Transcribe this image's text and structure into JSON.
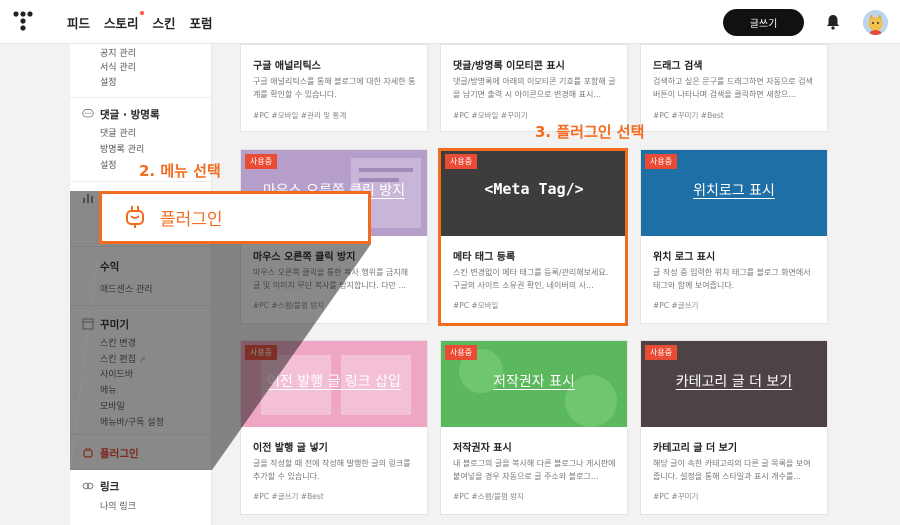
{
  "header": {
    "nav": [
      "피드",
      "스토리",
      "스킨",
      "포럼"
    ],
    "write_label": "글쓰기"
  },
  "sidebar": {
    "top_items": [
      "공지 관리",
      "서식 관리",
      "설정"
    ],
    "comment": {
      "title": "댓글 · 방명록",
      "items": [
        "댓글 관리",
        "방명록 관리",
        "설정"
      ]
    },
    "revenue": {
      "title": "수익",
      "items": [
        "애드센스 관리"
      ]
    },
    "decorate": {
      "title": "꾸미기",
      "items": [
        "스킨 변경",
        "스킨 편집",
        "사이드바",
        "메뉴",
        "모바일",
        "메뉴바/구독 설정"
      ]
    },
    "plugin": {
      "title": "플러그인"
    },
    "link": {
      "title": "링크",
      "items": [
        "나의 링크"
      ]
    }
  },
  "annotations": {
    "step2": "2. 메뉴 선택",
    "step2_label": "플러그인",
    "step3": "3. 플러그인 선택"
  },
  "cards": [
    {
      "title": "구글 애널리틱스",
      "desc": "구글 애널리틱스를 통해 블로그에 대한 자세한 통계를 확인할 수 있습니다.",
      "tags": "#PC   #모바일   #관리 및 통계"
    },
    {
      "title": "댓글/방명록 이모티콘 표시",
      "desc": "댓글/방명록에 아래의 이모티콘 기호를 포함해 글을 남기면 출력 시 아이콘으로 변경해 표시...",
      "tags": "#PC   #모바일   #꾸미기"
    },
    {
      "title": "드래그 검색",
      "desc": "검색하고 싶은 문구를 드래그하면 자동으로 검색 버튼이 나타나며 검색을 클릭하면 새창으...",
      "tags": "#PC   #꾸미기   #Best"
    },
    {
      "badge": "사용중",
      "thumb": "마우스 오른쪽 클릭 방지",
      "title": "마우스 오른쪽 클릭 방지",
      "desc": "마우스 오른쪽 클릭을 통한 복사 행위를 금지해 글 및 이미지 무단 복사를 방지합니다. 다만 ...",
      "tags": "#PC   #스팸/불펌 방지"
    },
    {
      "badge": "사용중",
      "thumb": "<Meta Tag/>",
      "title": "메타 태그 등록",
      "desc": "스킨 변경없이 메타 태그를 등록/관리해보세요. 구글의 사이트 소유권 확인, 네이버의 사...",
      "tags": "#PC   #모바일"
    },
    {
      "badge": "사용중",
      "thumb": "위치로그 표시",
      "title": "위치 로그 표시",
      "desc": "글 작성 중 입력한 위치 태그를 블로그 화면에서 태그와 함께 보여줍니다.",
      "tags": "#PC   #글쓰기"
    },
    {
      "badge": "사용중",
      "thumb": "이전 발행 글 링크 삽입",
      "title": "이전 발행 글 넣기",
      "desc": "글을 작성할 때 전에 작성해 발행한 글의 링크를 추가할 수 있습니다.",
      "tags": "#PC   #글쓰기   #Best"
    },
    {
      "badge": "사용중",
      "thumb": "저작권자 표시",
      "title": "저작권자 표시",
      "desc": "내 블로그의 글을 복사해 다른 블로그나 게시판에 붙여넣을 경우 자동으로 글 주소와 블로그...",
      "tags": "#PC   #스팸/불펌 방지"
    },
    {
      "badge": "사용중",
      "thumb": "카테고리 글 더 보기",
      "title": "카테고리 글 더 보기",
      "desc": "해당 글이 속한 카테고리의 다른 글 목록을 보여줍니다. 설정을 통해 스타일과 표시 개수를...",
      "tags": "#PC   #꾸미기"
    }
  ],
  "colors": {
    "accent": "#f26c1f",
    "badge": "#ea4b35",
    "thumb_purple": "#b59ec9",
    "thumb_dark": "#3d3d3d",
    "thumb_blue": "#1d6fa5",
    "thumb_pink": "#eea6c4",
    "thumb_green": "#5cb85c",
    "thumb_brown": "#4d4344"
  }
}
